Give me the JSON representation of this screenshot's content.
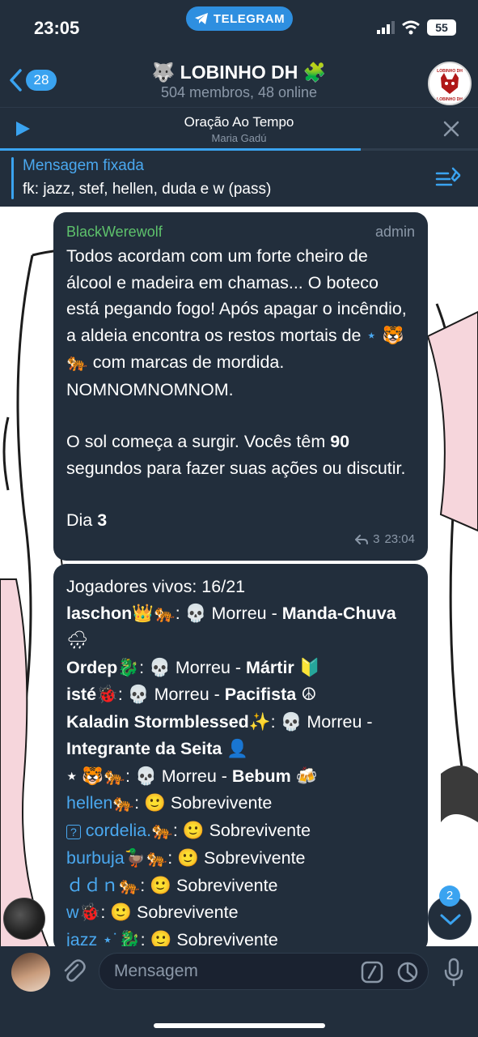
{
  "status": {
    "time": "23:05",
    "pill_label": "TELEGRAM",
    "battery": "55"
  },
  "header": {
    "back_count": "28",
    "title": "LOBINHO DH",
    "title_emoji_left": "🐺",
    "title_emoji_right": "🧩",
    "subtitle": "504 membros, 48 online",
    "avatar_text_top": "LOBINHO DH",
    "avatar_text_bottom": "LOBINHO DH"
  },
  "player": {
    "title": "Oração Ao Tempo",
    "artist": "Maria Gadú",
    "progress": 0.755
  },
  "pinned": {
    "label": "Mensagem fixada",
    "text": "fk: jazz, stef, hellen, duda e w (pass)"
  },
  "messages": [
    {
      "sender": "BlackWerewolf",
      "tag": "admin",
      "p1": "Todos acordam com um forte cheiro de álcool e madeira em chamas... O boteco está pegando fogo! Após apagar o incêndio, a aldeia encontra os restos mortais de ",
      "p1_name": "⋆ 🐯🐅",
      "p1_end": " com marcas de mordida. NOMNOMNOMNOM.",
      "p2_start": "O sol começa a surgir. Vocês têm ",
      "p2_num": "90",
      "p2_end": " segundos para fazer suas ações ou discutir.",
      "p3_start": "Dia ",
      "p3_num": "3",
      "replies": "3",
      "time": "23:04"
    },
    {
      "header": "Jogadores vivos: 16/21",
      "dead": [
        {
          "name": "laschon",
          "emoji": "👑🐅",
          "skull": "💀",
          "status": "Morreu",
          "role": "Manda-Chuva",
          "role_emoji": "🌧"
        },
        {
          "name": "Ordep",
          "emoji": "🐉",
          "skull": "💀",
          "status": "Morreu",
          "role": "Mártir",
          "role_emoji": "🔰"
        },
        {
          "name": "isté",
          "emoji": "🐞",
          "skull": "💀",
          "status": "Morreu",
          "role": "Pacifista",
          "role_emoji": "☮"
        },
        {
          "name": "Kaladin Stormblessed",
          "emoji": "✨",
          "skull": "💀",
          "status": "Morreu",
          "role": "Integrante da Seita",
          "role_emoji": "👤"
        },
        {
          "name": "⋆ 🐯🐅",
          "emoji": "",
          "skull": "💀",
          "status": "Morreu",
          "role": "Bebum",
          "role_emoji": "🍻"
        }
      ],
      "alive": [
        {
          "name": "hellen",
          "emoji": "🐅",
          "face": "🙂",
          "status": "Sobrevivente"
        },
        {
          "name": "cordelia.",
          "prefix": "?",
          "emoji": "🐅",
          "face": "🙂",
          "status": "Sobrevivente"
        },
        {
          "name": "burbuja",
          "emoji": "🦆🐅",
          "face": "🙂",
          "status": "Sobrevivente"
        },
        {
          "name": "ｄｄｎ",
          "emoji": "🐅",
          "face": "🙂",
          "status": "Sobrevivente"
        },
        {
          "name": "w",
          "emoji": "🐞",
          "face": "🙂",
          "status": "Sobrevivente"
        },
        {
          "name": "jazz ⋆˙",
          "emoji": "🐉",
          "face": "🙂",
          "status": "Sobrevivente"
        }
      ]
    }
  ],
  "scroll_badge": "2",
  "input": {
    "placeholder": "Mensagem"
  },
  "colors": {
    "accent": "#3aa3f0",
    "header_bg": "#222e3c",
    "bubble_bg": "#222e3c",
    "sender": "#5ec26c",
    "meta": "#8b98a8"
  }
}
